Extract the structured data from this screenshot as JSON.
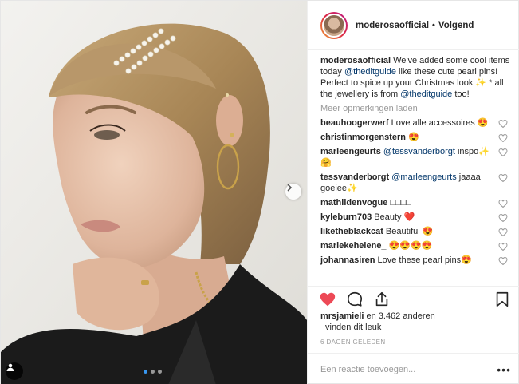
{
  "post": {
    "username": "moderosaofficial",
    "separator": "•",
    "follow_label": "Volgend",
    "caption": {
      "username": "moderosaofficial",
      "text_1": " We've added some cool items today ",
      "mention_1": "@theditguide",
      "text_2": " like these cute pearl pins! Perfect to spice up your Christmas look ✨ * all the jewellery is from ",
      "mention_2": "@theditguide",
      "text_3": " too!"
    },
    "load_more_label": "Meer opmerkingen laden",
    "comments": [
      {
        "username": "beauhoogerwerf",
        "text": " Love alle accessoires 😍"
      },
      {
        "username": "christinmorgenstern",
        "text": " 😍"
      },
      {
        "username": "marleengeurts",
        "mention": " @tessvanderborgt",
        "text": " inspo✨🤗"
      },
      {
        "username": "tessvanderborgt",
        "mention": " @marleengeurts",
        "text": " jaaaa goeiee✨"
      },
      {
        "username": "mathildenvogue",
        "text": " □□□□"
      },
      {
        "username": "kyleburn703",
        "text": " Beauty ❤️"
      },
      {
        "username": "liketheblackcat",
        "text": " Beautiful 😍"
      },
      {
        "username": "mariekehelene_",
        "text": " 😍😍😍😍"
      },
      {
        "username": "johannasiren",
        "text": " Love these pearl pins😍"
      }
    ],
    "likes": {
      "user": "mrsjamieli",
      "text": " en 3.462 anderen",
      "line2": "vinden dit leuk"
    },
    "timestamp": "6 DAGEN GELEDEN",
    "add_comment_placeholder": "Een reactie toevoegen...",
    "more_label": "•••"
  },
  "icons": {
    "like": "heart-icon",
    "comment": "comment-icon",
    "share": "share-icon",
    "save": "bookmark-icon",
    "comment_like": "small-heart-icon",
    "next": "chevron-right-icon",
    "tag": "person-tag-icon"
  },
  "colors": {
    "like_active": "#ed4956",
    "mention": "#003569",
    "secondary_text": "#999999",
    "carousel_active_dot": "#3897f0"
  }
}
